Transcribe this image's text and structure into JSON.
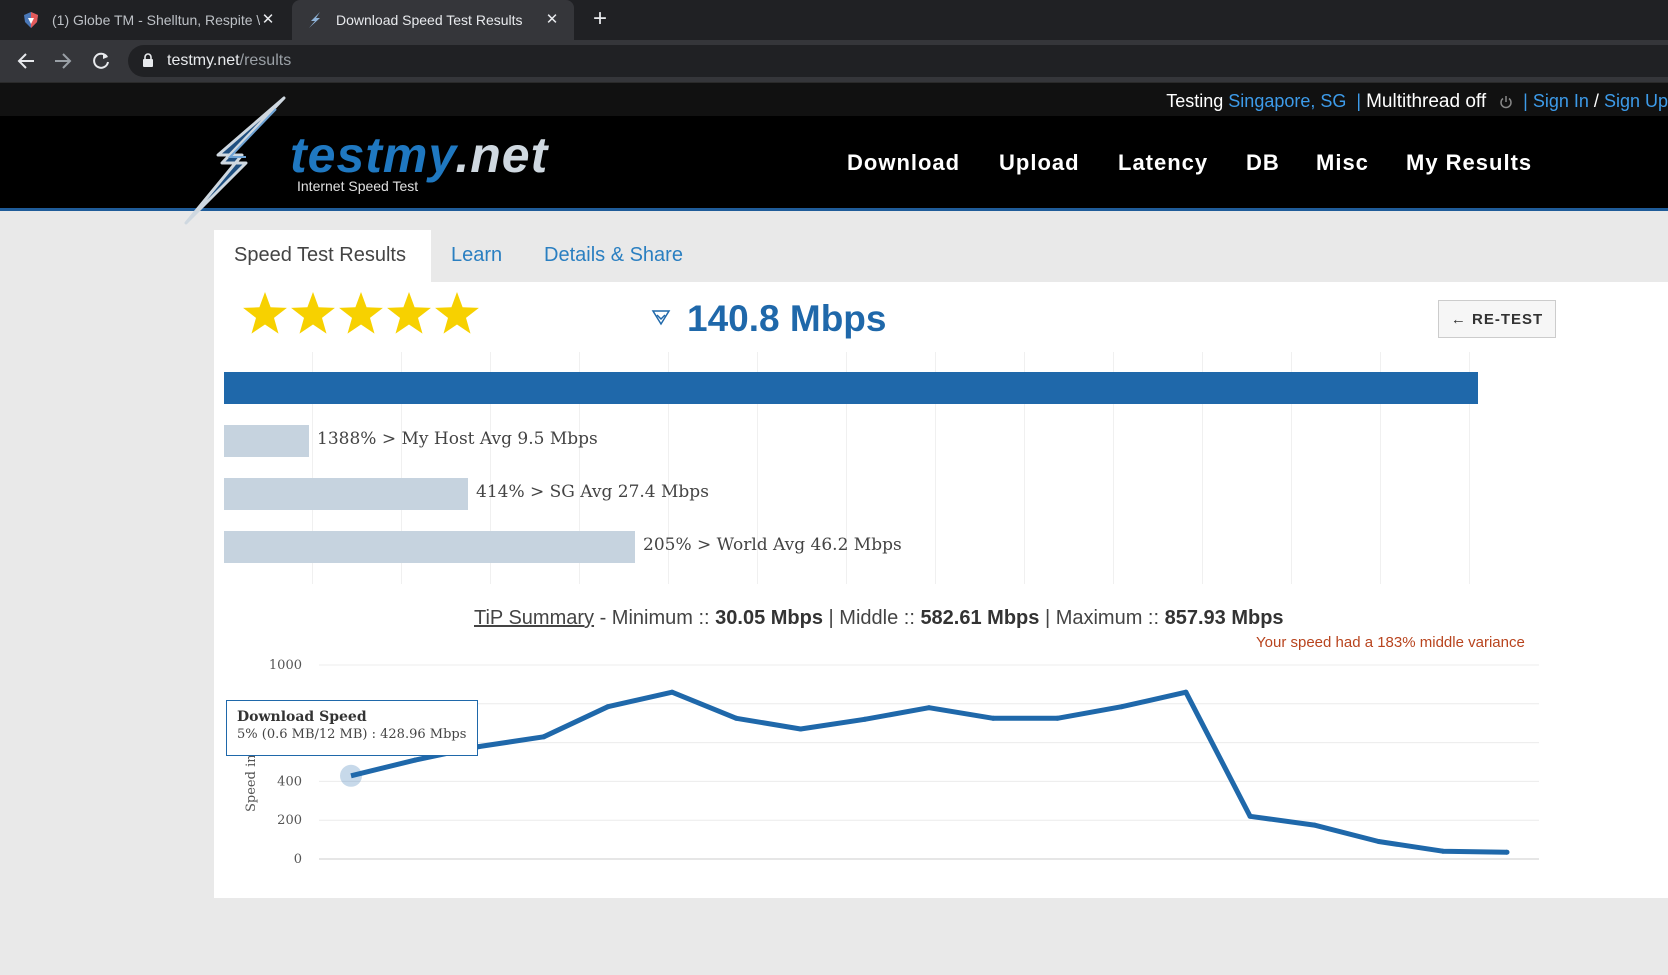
{
  "browser": {
    "tabs": [
      {
        "title": "(1) Globe TM - Shelltun, Respite \\"
      },
      {
        "title": "Download Speed Test Results"
      }
    ],
    "new_tab": "+",
    "url_host": "testmy.net",
    "url_path": "/results"
  },
  "site": {
    "testing_label": "Testing",
    "location": "Singapore, SG",
    "bar": "|",
    "multithread": "Multithread off",
    "sign_in": "Sign In",
    "slash": "/",
    "sign_up": "Sign Up",
    "logo_main": "testmy",
    "logo_tld": ".net",
    "logo_sub": "Internet Speed Test",
    "menu": [
      "Download",
      "Upload",
      "Latency",
      "DB",
      "Misc",
      "My Results"
    ]
  },
  "results": {
    "tabs": [
      "Speed Test Results",
      "Learn",
      "Details & Share"
    ],
    "rating_stars": 5,
    "speed": "140.8 Mbps",
    "retest_label": "← RE-TEST",
    "comparisons": [
      {
        "label": "1388% > My Host Avg 9.5 Mbps",
        "value": 9.5
      },
      {
        "label": "414% > SG Avg 27.4 Mbps",
        "value": 27.4
      },
      {
        "label": "205% > World Avg 46.2 Mbps",
        "value": 46.2
      }
    ],
    "tip_link": "TiP Summary",
    "tip_dash": " - Minimum :: ",
    "tip_min": "30.05 Mbps",
    "tip_mid_label": " | Middle :: ",
    "tip_mid": "582.61 Mbps",
    "tip_max_label": " | Maximum :: ",
    "tip_max": "857.93 Mbps",
    "variance": "Your speed had a 183% middle variance",
    "tooltip_title": "Download Speed",
    "tooltip_value": "5% (0.6 MB/12 MB) : 428.96 Mbps"
  },
  "chart_data": {
    "type": "line",
    "ylabel": "Speed in",
    "ylim": [
      0,
      1000
    ],
    "yticks": [
      "0",
      "200",
      "400",
      "1000"
    ],
    "series": [
      {
        "values": [
          429,
          510,
          580,
          630,
          785,
          860,
          725,
          670,
          720,
          780,
          725,
          725,
          785,
          860,
          220,
          175,
          90,
          40,
          35
        ]
      }
    ],
    "color": "#1f68aa"
  }
}
